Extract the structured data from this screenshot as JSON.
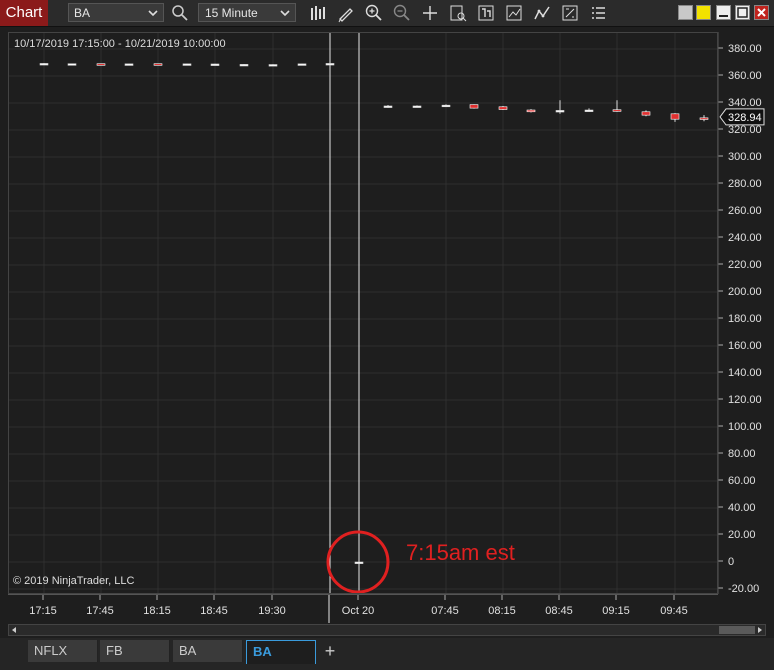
{
  "window": {
    "title": "Chart",
    "instrument": "BA",
    "interval": "15 Minute"
  },
  "chart_data": {
    "type": "candlestick",
    "date_range": "10/17/2019 17:15:00 - 10/21/2019 10:00:00",
    "copyright": "© 2019 NinjaTrader, LLC",
    "annotation": "7:15am est",
    "current_price_label": "328.94",
    "ylim": [
      -20,
      390
    ],
    "y_ticks": [
      "380.00",
      "360.00",
      "340.00",
      "320.00",
      "300.00",
      "280.00",
      "260.00",
      "240.00",
      "220.00",
      "200.00",
      "180.00",
      "160.00",
      "140.00",
      "120.00",
      "100.00",
      "80.00",
      "60.00",
      "40.00",
      "20.00",
      "0",
      "-20.00"
    ],
    "y_tick_values": [
      380,
      360,
      340,
      320,
      300,
      280,
      260,
      240,
      220,
      200,
      180,
      160,
      140,
      120,
      100,
      80,
      60,
      40,
      20,
      0,
      -20
    ],
    "x_ticks": [
      "17:15",
      "17:45",
      "18:15",
      "18:45",
      "19:30",
      "Oct 20",
      "07:45",
      "08:15",
      "08:45",
      "09:15",
      "09:45"
    ],
    "candles_session1": [
      {
        "o": 369.2,
        "h": 369.5,
        "l": 369.0,
        "c": 369.3
      },
      {
        "o": 369.0,
        "h": 369.3,
        "l": 368.8,
        "c": 369.1
      },
      {
        "o": 369.1,
        "h": 369.3,
        "l": 368.9,
        "c": 369.0
      },
      {
        "o": 369.0,
        "h": 369.2,
        "l": 368.8,
        "c": 369.0
      },
      {
        "o": 369.1,
        "h": 369.3,
        "l": 368.9,
        "c": 368.9
      },
      {
        "o": 369.0,
        "h": 369.2,
        "l": 368.8,
        "c": 369.0
      },
      {
        "o": 368.9,
        "h": 369.1,
        "l": 368.7,
        "c": 368.9
      },
      {
        "o": 368.6,
        "h": 368.8,
        "l": 368.4,
        "c": 368.6
      },
      {
        "o": 368.5,
        "h": 368.7,
        "l": 368.3,
        "c": 368.5
      },
      {
        "o": 369.0,
        "h": 369.2,
        "l": 368.8,
        "c": 369.0
      },
      {
        "o": 369.2,
        "h": 369.4,
        "l": 369.0,
        "c": 369.3
      }
    ],
    "single_bar": {
      "o": 0,
      "h": 0.5,
      "l": -0.5,
      "c": 0
    },
    "candles_session2": [
      {
        "o": 337.5,
        "h": 338.5,
        "l": 336.5,
        "c": 337.8
      },
      {
        "o": 337.6,
        "h": 338.2,
        "l": 337.0,
        "c": 337.8
      },
      {
        "o": 338.0,
        "h": 339.0,
        "l": 337.6,
        "c": 338.4
      },
      {
        "o": 338.8,
        "h": 339.0,
        "l": 335.8,
        "c": 336.2
      },
      {
        "o": 337.2,
        "h": 337.8,
        "l": 334.8,
        "c": 335.2
      },
      {
        "o": 334.8,
        "h": 335.5,
        "l": 333.0,
        "c": 333.5
      },
      {
        "o": 333.9,
        "h": 342.0,
        "l": 332.0,
        "c": 334.5
      },
      {
        "o": 334.5,
        "h": 336.0,
        "l": 333.5,
        "c": 334.8
      },
      {
        "o": 335.0,
        "h": 342.0,
        "l": 333.5,
        "c": 334.6
      },
      {
        "o": 333.5,
        "h": 334.5,
        "l": 330.2,
        "c": 331.0
      },
      {
        "o": 332.0,
        "h": 332.5,
        "l": 326.0,
        "c": 328.0
      },
      {
        "o": 329.0,
        "h": 331.0,
        "l": 326.5,
        "c": 328.9
      }
    ]
  },
  "bottom_tabs": [
    "NFLX",
    "FB",
    "BA",
    "BA"
  ],
  "colors": {
    "background": "#1e1e1e",
    "grid": "#2f2f2f",
    "up": "#ffffff",
    "down": "#e03030",
    "accent": "#3a9bdc",
    "annotation": "#e02020"
  }
}
